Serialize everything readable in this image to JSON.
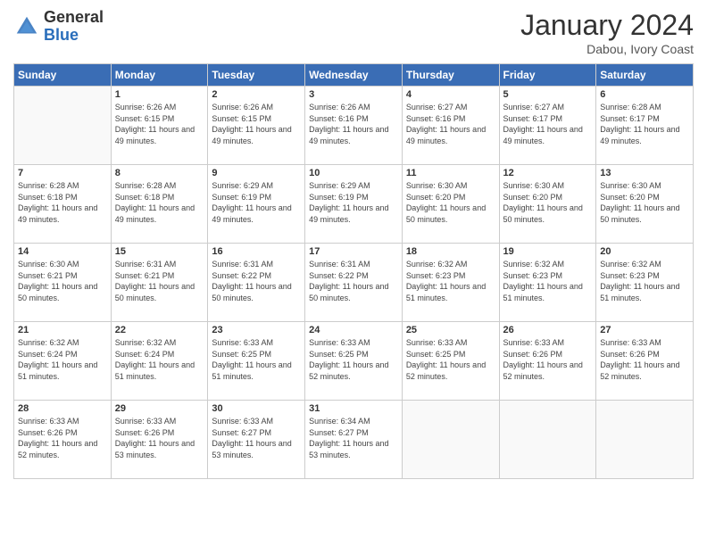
{
  "header": {
    "logo_general": "General",
    "logo_blue": "Blue",
    "month_title": "January 2024",
    "subtitle": "Dabou, Ivory Coast"
  },
  "weekdays": [
    "Sunday",
    "Monday",
    "Tuesday",
    "Wednesday",
    "Thursday",
    "Friday",
    "Saturday"
  ],
  "weeks": [
    [
      {
        "day": null
      },
      {
        "day": 1,
        "sunrise": "6:26 AM",
        "sunset": "6:15 PM",
        "daylight": "11 hours and 49 minutes."
      },
      {
        "day": 2,
        "sunrise": "6:26 AM",
        "sunset": "6:15 PM",
        "daylight": "11 hours and 49 minutes."
      },
      {
        "day": 3,
        "sunrise": "6:26 AM",
        "sunset": "6:16 PM",
        "daylight": "11 hours and 49 minutes."
      },
      {
        "day": 4,
        "sunrise": "6:27 AM",
        "sunset": "6:16 PM",
        "daylight": "11 hours and 49 minutes."
      },
      {
        "day": 5,
        "sunrise": "6:27 AM",
        "sunset": "6:17 PM",
        "daylight": "11 hours and 49 minutes."
      },
      {
        "day": 6,
        "sunrise": "6:28 AM",
        "sunset": "6:17 PM",
        "daylight": "11 hours and 49 minutes."
      }
    ],
    [
      {
        "day": 7,
        "sunrise": "6:28 AM",
        "sunset": "6:18 PM",
        "daylight": "11 hours and 49 minutes."
      },
      {
        "day": 8,
        "sunrise": "6:28 AM",
        "sunset": "6:18 PM",
        "daylight": "11 hours and 49 minutes."
      },
      {
        "day": 9,
        "sunrise": "6:29 AM",
        "sunset": "6:19 PM",
        "daylight": "11 hours and 49 minutes."
      },
      {
        "day": 10,
        "sunrise": "6:29 AM",
        "sunset": "6:19 PM",
        "daylight": "11 hours and 49 minutes."
      },
      {
        "day": 11,
        "sunrise": "6:30 AM",
        "sunset": "6:20 PM",
        "daylight": "11 hours and 50 minutes."
      },
      {
        "day": 12,
        "sunrise": "6:30 AM",
        "sunset": "6:20 PM",
        "daylight": "11 hours and 50 minutes."
      },
      {
        "day": 13,
        "sunrise": "6:30 AM",
        "sunset": "6:20 PM",
        "daylight": "11 hours and 50 minutes."
      }
    ],
    [
      {
        "day": 14,
        "sunrise": "6:30 AM",
        "sunset": "6:21 PM",
        "daylight": "11 hours and 50 minutes."
      },
      {
        "day": 15,
        "sunrise": "6:31 AM",
        "sunset": "6:21 PM",
        "daylight": "11 hours and 50 minutes."
      },
      {
        "day": 16,
        "sunrise": "6:31 AM",
        "sunset": "6:22 PM",
        "daylight": "11 hours and 50 minutes."
      },
      {
        "day": 17,
        "sunrise": "6:31 AM",
        "sunset": "6:22 PM",
        "daylight": "11 hours and 50 minutes."
      },
      {
        "day": 18,
        "sunrise": "6:32 AM",
        "sunset": "6:23 PM",
        "daylight": "11 hours and 51 minutes."
      },
      {
        "day": 19,
        "sunrise": "6:32 AM",
        "sunset": "6:23 PM",
        "daylight": "11 hours and 51 minutes."
      },
      {
        "day": 20,
        "sunrise": "6:32 AM",
        "sunset": "6:23 PM",
        "daylight": "11 hours and 51 minutes."
      }
    ],
    [
      {
        "day": 21,
        "sunrise": "6:32 AM",
        "sunset": "6:24 PM",
        "daylight": "11 hours and 51 minutes."
      },
      {
        "day": 22,
        "sunrise": "6:32 AM",
        "sunset": "6:24 PM",
        "daylight": "11 hours and 51 minutes."
      },
      {
        "day": 23,
        "sunrise": "6:33 AM",
        "sunset": "6:25 PM",
        "daylight": "11 hours and 51 minutes."
      },
      {
        "day": 24,
        "sunrise": "6:33 AM",
        "sunset": "6:25 PM",
        "daylight": "11 hours and 52 minutes."
      },
      {
        "day": 25,
        "sunrise": "6:33 AM",
        "sunset": "6:25 PM",
        "daylight": "11 hours and 52 minutes."
      },
      {
        "day": 26,
        "sunrise": "6:33 AM",
        "sunset": "6:26 PM",
        "daylight": "11 hours and 52 minutes."
      },
      {
        "day": 27,
        "sunrise": "6:33 AM",
        "sunset": "6:26 PM",
        "daylight": "11 hours and 52 minutes."
      }
    ],
    [
      {
        "day": 28,
        "sunrise": "6:33 AM",
        "sunset": "6:26 PM",
        "daylight": "11 hours and 52 minutes."
      },
      {
        "day": 29,
        "sunrise": "6:33 AM",
        "sunset": "6:26 PM",
        "daylight": "11 hours and 53 minutes."
      },
      {
        "day": 30,
        "sunrise": "6:33 AM",
        "sunset": "6:27 PM",
        "daylight": "11 hours and 53 minutes."
      },
      {
        "day": 31,
        "sunrise": "6:34 AM",
        "sunset": "6:27 PM",
        "daylight": "11 hours and 53 minutes."
      },
      {
        "day": null
      },
      {
        "day": null
      },
      {
        "day": null
      }
    ]
  ]
}
